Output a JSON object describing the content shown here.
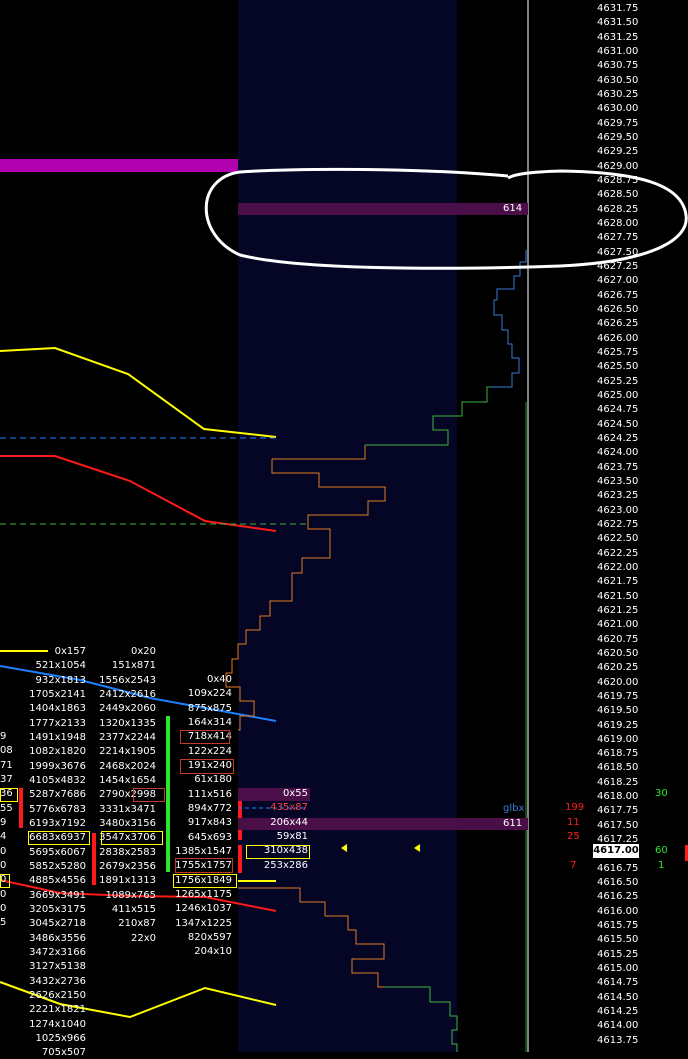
{
  "colors": {
    "background": "#000000",
    "profile_panel": "#050525",
    "magenta": "#b000b0",
    "bar_purple": "#4a0f48",
    "yellow": "#ffff00",
    "red": "#ff1a1a",
    "blue_line": "#1e7fff",
    "orange_step": "#e07b22",
    "green_step": "#3cb43c",
    "blue_step": "#3a7ad6"
  },
  "price_ladder": [
    "4631.75",
    "4631.50",
    "4631.25",
    "4631.00",
    "4630.75",
    "4630.50",
    "4630.25",
    "4630.00",
    "4629.75",
    "4629.50",
    "4629.25",
    "4629.00",
    "4628.75",
    "4628.50",
    "4628.25",
    "4628.00",
    "4627.75",
    "4627.50",
    "4627.25",
    "4627.00",
    "4626.75",
    "4626.50",
    "4626.25",
    "4626.00",
    "4625.75",
    "4625.50",
    "4625.25",
    "4625.00",
    "4624.75",
    "4624.50",
    "4624.25",
    "4624.00",
    "4623.75",
    "4623.50",
    "4623.25",
    "4623.00",
    "4622.75",
    "4622.50",
    "4622.25",
    "4622.00",
    "4621.75",
    "4621.50",
    "4621.25",
    "4621.00",
    "4620.75",
    "4620.50",
    "4620.25",
    "4620.00",
    "4619.75",
    "4619.50",
    "4619.25",
    "4619.00",
    "4618.75",
    "4618.50",
    "4618.25",
    "4618.00",
    "4617.75",
    "4617.50",
    "4617.25",
    "4617.00",
    "4616.75",
    "4616.50",
    "4616.25",
    "4616.00",
    "4615.75",
    "4615.50",
    "4615.25",
    "4615.00",
    "4614.75",
    "4614.50",
    "4614.25",
    "4614.00",
    "4613.75"
  ],
  "current_price": "4617.00",
  "volume_labels": {
    "top_bar": "614",
    "mid_bar": "611",
    "glbx": "glbx"
  },
  "footprint_col1": [
    "0x157",
    "521x1054",
    "932x1813",
    "1705x2141",
    "1404x1863",
    "1777x2133",
    "1491x1948",
    "1082x1820",
    "1999x3676",
    "4105x4832",
    "5287x7686",
    "5776x6783",
    "6193x7192",
    "6683x6937",
    "5695x6067",
    "5852x5280",
    "4885x4556",
    "3669x3491",
    "3205x3175",
    "3045x2718",
    "3486x3556",
    "3472x3166",
    "3127x5138",
    "3432x2736",
    "2626x2150",
    "2221x1821",
    "1274x1040",
    "1025x966",
    "705x507"
  ],
  "footprint_col2": [
    "0x20",
    "151x871",
    "1556x2543",
    "2412x2616",
    "2449x2060",
    "1320x1335",
    "2377x2244",
    "2214x1905",
    "2468x2024",
    "1454x1654",
    "2790x2998",
    "3331x3471",
    "3480x3156",
    "3547x3706",
    "2838x2583",
    "2679x2356",
    "1891x1313",
    "1089x765",
    "411x515",
    "210x87",
    "22x0"
  ],
  "footprint_col3": [
    "0x40",
    "109x224",
    "875x875",
    "164x314",
    "718x414",
    "122x224",
    "191x240",
    "61x180",
    "111x516",
    "894x772",
    "917x843",
    "645x693",
    "1385x1547",
    "1755x1757",
    "1756x1849",
    "1265x1175",
    "1246x1037",
    "1347x1225",
    "820x597",
    "204x10"
  ],
  "footprint_col4": [
    "0x55",
    "435x87",
    "206x44",
    "59x81",
    "310x438",
    "253x286"
  ],
  "left_edge_fragments": [
    "9",
    "08",
    "71",
    "37",
    "36",
    "55",
    "9",
    "4",
    "0",
    "0",
    "0",
    "0",
    "0",
    "5"
  ],
  "right_red_numbers": [
    "199",
    "11",
    "25",
    "7"
  ],
  "right_green_numbers": [
    "30",
    "60",
    "1"
  ]
}
